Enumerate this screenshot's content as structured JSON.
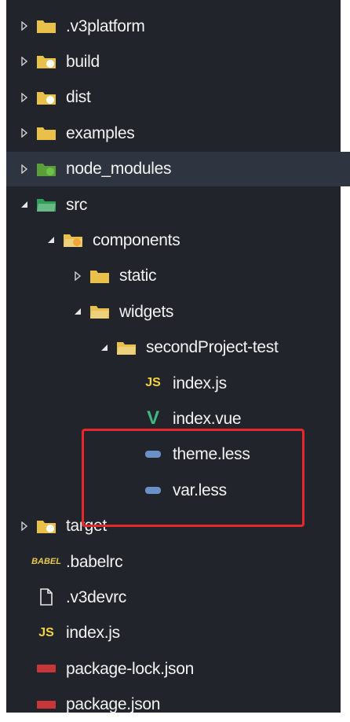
{
  "explorer": {
    "items": [
      {
        "label": ".v3platform",
        "icon": "folder-icon",
        "expanded": false,
        "depth": 0
      },
      {
        "label": "build",
        "icon": "folder-build-icon",
        "expanded": false,
        "depth": 0
      },
      {
        "label": "dist",
        "icon": "folder-dist-icon",
        "expanded": false,
        "depth": 0
      },
      {
        "label": "examples",
        "icon": "folder-icon",
        "expanded": false,
        "depth": 0
      },
      {
        "label": "node_modules",
        "icon": "folder-node-icon",
        "expanded": false,
        "depth": 0,
        "selected": true
      },
      {
        "label": "src",
        "icon": "folder-src-open-icon",
        "expanded": true,
        "depth": 0
      },
      {
        "label": "components",
        "icon": "folder-components-open-icon",
        "expanded": true,
        "depth": 1
      },
      {
        "label": "static",
        "icon": "folder-icon",
        "expanded": false,
        "depth": 2
      },
      {
        "label": "widgets",
        "icon": "folder-open-icon",
        "expanded": true,
        "depth": 2
      },
      {
        "label": "secondProject-test",
        "icon": "folder-open-icon",
        "expanded": true,
        "depth": 3
      },
      {
        "label": "index.js",
        "icon": "js-file-icon",
        "badge": "JS",
        "depth": 4
      },
      {
        "label": "index.vue",
        "icon": "vue-file-icon",
        "badge": "V",
        "depth": 4
      },
      {
        "label": "theme.less",
        "icon": "less-file-icon",
        "depth": 4
      },
      {
        "label": "var.less",
        "icon": "less-file-icon",
        "depth": 4
      },
      {
        "label": "target",
        "icon": "folder-target-icon",
        "expanded": false,
        "depth": 0
      },
      {
        "label": ".babelrc",
        "icon": "babel-file-icon",
        "badge": "BABEL",
        "depth": 0
      },
      {
        "label": ".v3devrc",
        "icon": "file-icon",
        "depth": 0
      },
      {
        "label": "index.js",
        "icon": "js-file-icon",
        "badge": "JS",
        "depth": 0
      },
      {
        "label": "package-lock.json",
        "icon": "npm-file-icon",
        "depth": 0
      },
      {
        "label": "package.json",
        "icon": "npm-file-icon",
        "depth": 0
      }
    ]
  },
  "colors": {
    "panel_bg": "#21252b",
    "selected_bg": "#2e3440",
    "text": "#f2f2f2",
    "folder": "#e8c04a",
    "folder_src": "#2f9e57",
    "node_green": "#6cc24a",
    "js": "#f5d33e",
    "vue": "#41b883",
    "less": "#6a90c7",
    "npm": "#c7373a",
    "highlight": "#e8262b"
  }
}
